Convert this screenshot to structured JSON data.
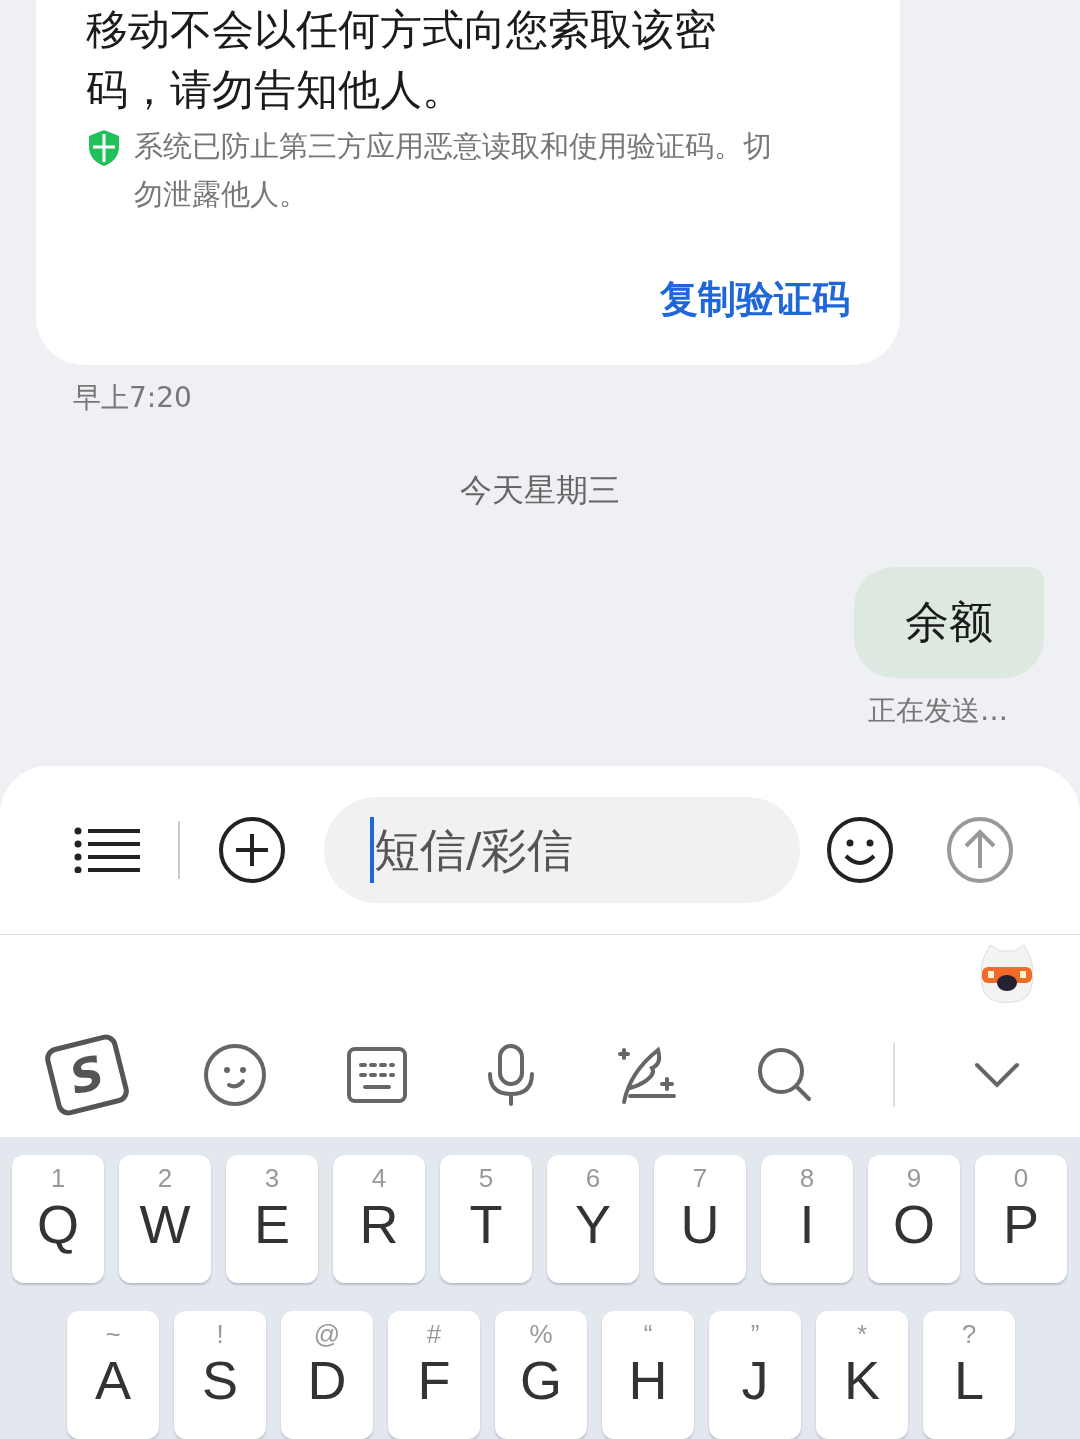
{
  "message_card": {
    "lines": [
      "移动不会以任何方式向您索取该密",
      "码，请勿告知他人。"
    ],
    "security_note": "系统已防止第三方应用恶意读取和使用验证码。切勿泄露他人。",
    "action": "复制验证码"
  },
  "timestamp": "早上7:20",
  "date_divider": "今天星期三",
  "outgoing": {
    "text": "余额",
    "status": "正在发送…"
  },
  "composer": {
    "placeholder": "短信/彩信"
  },
  "ime_toolbar": {
    "logo": "S"
  },
  "keyboard": [
    [
      {
        "hint": "1",
        "key": "Q"
      },
      {
        "hint": "2",
        "key": "W"
      },
      {
        "hint": "3",
        "key": "E"
      },
      {
        "hint": "4",
        "key": "R"
      },
      {
        "hint": "5",
        "key": "T"
      },
      {
        "hint": "6",
        "key": "Y"
      },
      {
        "hint": "7",
        "key": "U"
      },
      {
        "hint": "8",
        "key": "I"
      },
      {
        "hint": "9",
        "key": "O"
      },
      {
        "hint": "0",
        "key": "P"
      }
    ],
    [
      {
        "hint": "~",
        "key": "A"
      },
      {
        "hint": "!",
        "key": "S"
      },
      {
        "hint": "@",
        "key": "D"
      },
      {
        "hint": "#",
        "key": "F"
      },
      {
        "hint": "%",
        "key": "G"
      },
      {
        "hint": "“",
        "key": "H"
      },
      {
        "hint": "”",
        "key": "J"
      },
      {
        "hint": "*",
        "key": "K"
      },
      {
        "hint": "?",
        "key": "L"
      }
    ]
  ]
}
